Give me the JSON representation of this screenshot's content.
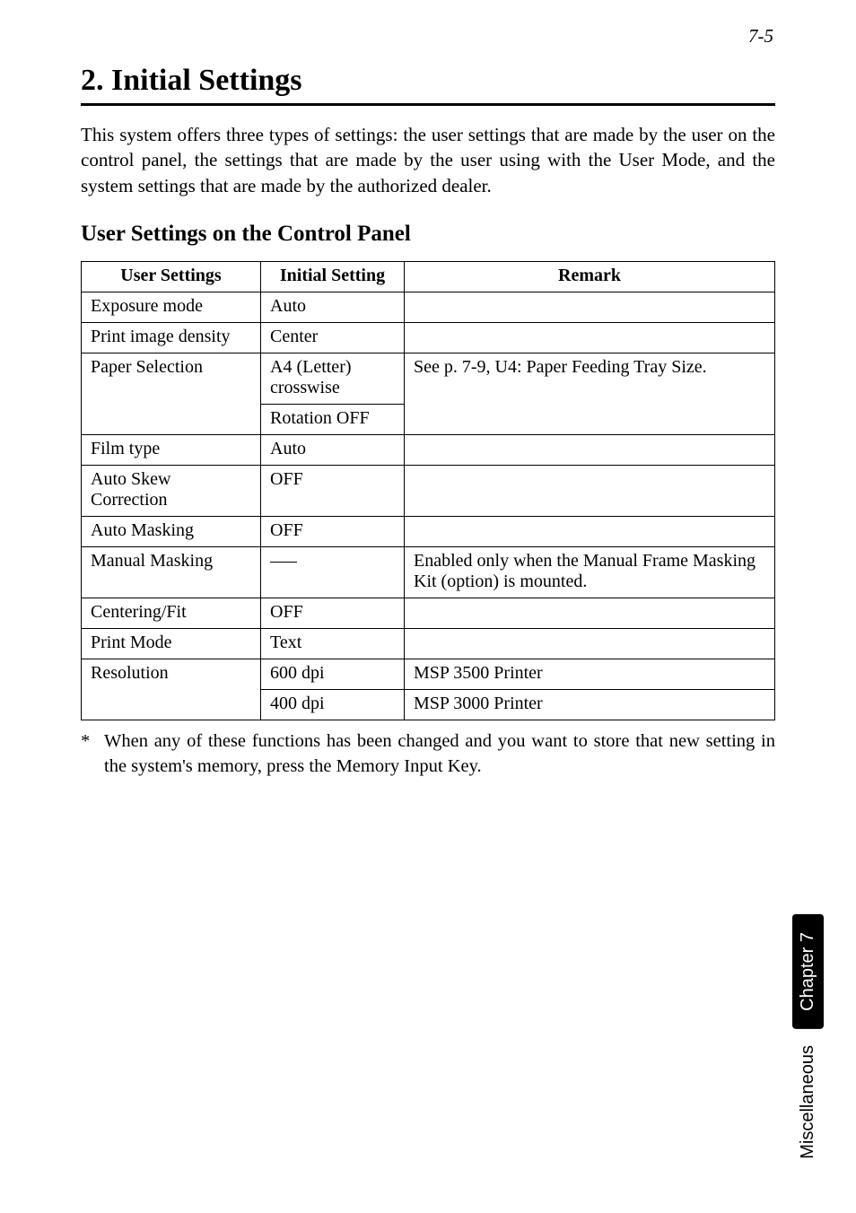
{
  "page_number": "7-5",
  "title": "2. Initial Settings",
  "intro": "This system offers three types of settings: the user settings that are made by the user on the control panel, the settings that are made by the user using with the User Mode, and the system settings that are made by the authorized dealer.",
  "subheading": "User Settings on the Control Panel",
  "table": {
    "headers": {
      "c0": "User Settings",
      "c1": "Initial Setting",
      "c2": "Remark"
    },
    "rows": {
      "r0": {
        "c0": "Exposure mode",
        "c1": "Auto",
        "c2": ""
      },
      "r1": {
        "c0": "Print image density",
        "c1": "Center",
        "c2": ""
      },
      "r2": {
        "c0": "Paper Selection",
        "c1": "A4 (Letter) crosswise",
        "c2": "See p. 7-9, U4: Paper Feeding Tray Size."
      },
      "r3": {
        "c1": "Rotation OFF",
        "c2": ""
      },
      "r4": {
        "c0": "Film type",
        "c1": "Auto",
        "c2": ""
      },
      "r5": {
        "c0": "Auto Skew Correction",
        "c1": "OFF",
        "c2": ""
      },
      "r6": {
        "c0": "Auto Masking",
        "c1": "OFF",
        "c2": ""
      },
      "r7": {
        "c0": "Manual Masking",
        "c2": "Enabled only when the Manual Frame Masking Kit (option) is mounted."
      },
      "r8": {
        "c0": "Centering/Fit",
        "c1": "OFF",
        "c2": ""
      },
      "r9": {
        "c0": "Print Mode",
        "c1": "Text",
        "c2": ""
      },
      "r10": {
        "c0": "Resolution",
        "c1": "600 dpi",
        "c2": "MSP 3500 Printer"
      },
      "r11": {
        "c1": "400 dpi",
        "c2": "MSP 3000 Printer"
      }
    }
  },
  "footnote_mark": "*",
  "footnote": "When any of these functions has been changed and you want to store that new setting in the system's memory, press the Memory Input Key.",
  "tabs": {
    "chapter": "Chapter 7",
    "section": "Miscellaneous"
  }
}
